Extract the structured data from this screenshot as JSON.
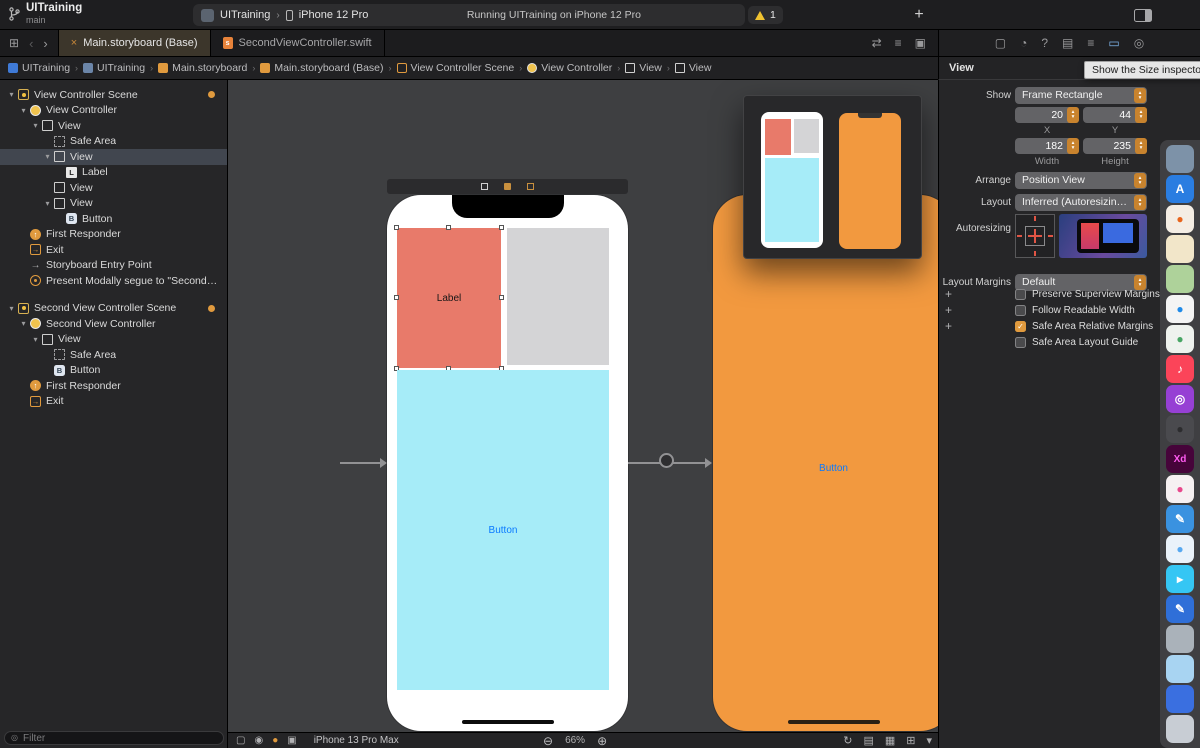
{
  "accent": "#e09a3e",
  "toolbar": {
    "project": "UITraining",
    "branch": "main",
    "scheme_app": "UITraining",
    "scheme_separator": "›",
    "scheme_device": "iPhone 12 Pro",
    "status": "Running UITraining on iPhone 12 Pro",
    "warning_count": "1",
    "add_button": "+"
  },
  "tabbar": {
    "close_glyph": "×",
    "swift_badge": "s",
    "nav_back": "‹",
    "nav_forward": "›",
    "grid_glyph": "⊞",
    "tabs": [
      {
        "label": "Main.storyboard (Base)"
      },
      {
        "label": "SecondViewController.swift"
      }
    ],
    "right_icons": [
      {
        "name": "editor-arrangement-icon",
        "glyph": "⇄"
      },
      {
        "name": "minimap-icon",
        "glyph": "≡"
      },
      {
        "name": "add-editor-icon",
        "glyph": "▣"
      }
    ]
  },
  "breadcrumb": {
    "separator": "›",
    "items": [
      {
        "icon": "app",
        "label": "UITraining"
      },
      {
        "icon": "folder",
        "label": "UITraining"
      },
      {
        "icon": "storyboard",
        "label": "Main.storyboard"
      },
      {
        "icon": "storyboard",
        "label": "Main.storyboard (Base)"
      },
      {
        "icon": "scene",
        "label": "View Controller Scene"
      },
      {
        "icon": "vc",
        "label": "View Controller"
      },
      {
        "icon": "view",
        "label": "View"
      },
      {
        "icon": "view",
        "label": "View"
      }
    ]
  },
  "outline": {
    "filter_placeholder": "Filter",
    "items": [
      {
        "label": "View Controller Scene",
        "indent": 0,
        "icon": "scene",
        "chevron": true,
        "dot": true
      },
      {
        "label": "View Controller",
        "indent": 1,
        "icon": "vc",
        "chevron": true
      },
      {
        "label": "View",
        "indent": 2,
        "icon": "view",
        "chevron": true
      },
      {
        "label": "Safe Area",
        "indent": 3,
        "icon": "safearea"
      },
      {
        "label": "View",
        "indent": 3,
        "icon": "view",
        "chevron": true,
        "selected": true
      },
      {
        "label": "Label",
        "indent": 4,
        "icon": "label"
      },
      {
        "label": "View",
        "indent": 3,
        "icon": "view"
      },
      {
        "label": "View",
        "indent": 3,
        "icon": "view",
        "chevron": true
      },
      {
        "label": "Button",
        "indent": 4,
        "icon": "button"
      },
      {
        "label": "First Responder",
        "indent": 1,
        "icon": "responder"
      },
      {
        "label": "Exit",
        "indent": 1,
        "icon": "exit"
      },
      {
        "label": "Storyboard Entry Point",
        "indent": 1,
        "icon": "entry"
      },
      {
        "label": "Present Modally segue to \"Second…",
        "indent": 1,
        "icon": "segue"
      },
      {
        "label": "Second View Controller Scene",
        "indent": 0,
        "icon": "scene",
        "chevron": true,
        "dot": true,
        "gap_before": true
      },
      {
        "label": "Second View Controller",
        "indent": 1,
        "icon": "vc",
        "chevron": true
      },
      {
        "label": "View",
        "indent": 2,
        "icon": "view",
        "chevron": true
      },
      {
        "label": "Safe Area",
        "indent": 3,
        "icon": "safearea"
      },
      {
        "label": "Button",
        "indent": 3,
        "icon": "button"
      },
      {
        "label": "First Responder",
        "indent": 1,
        "icon": "responder"
      },
      {
        "label": "Exit",
        "indent": 1,
        "icon": "exit"
      }
    ]
  },
  "canvas": {
    "phone1": {
      "label": "Label",
      "button": "Button"
    },
    "phone2": {
      "button": "Button"
    }
  },
  "canvas_bar": {
    "device": "iPhone 13 Pro Max",
    "zoom": "66%",
    "zoom_out": "⊖",
    "zoom_in": "⊕",
    "left_icons": [
      {
        "name": "device-bezels-icon",
        "glyph": "▢"
      },
      {
        "name": "orientation-icon",
        "glyph": "◉"
      },
      {
        "name": "appearance-icon",
        "glyph": "●",
        "color": "#e09a3e"
      },
      {
        "name": "adjust-variants-icon",
        "glyph": "▣"
      }
    ],
    "right_icons": [
      {
        "name": "update-frames-icon",
        "glyph": "↻"
      },
      {
        "name": "stack-icon",
        "glyph": "▤"
      },
      {
        "name": "align-icon",
        "glyph": "▦"
      },
      {
        "name": "add-constraints-icon",
        "glyph": "⊞"
      },
      {
        "name": "resolve-autolayout-icon",
        "glyph": "▾"
      }
    ]
  },
  "inspector": {
    "pane_title": "View",
    "tooltip": "Show the Size inspector",
    "tabs": [
      {
        "name": "file-inspector-tab",
        "glyph": "▢"
      },
      {
        "name": "history-inspector-tab",
        "glyph": "◔"
      },
      {
        "name": "quick-help-inspector-tab",
        "glyph": "?"
      },
      {
        "name": "identity-inspector-tab",
        "glyph": "▤"
      },
      {
        "name": "attributes-inspector-tab",
        "glyph": "≡"
      },
      {
        "name": "size-inspector-tab",
        "glyph": "▭",
        "active": true
      },
      {
        "name": "connections-inspector-tab",
        "glyph": "◎"
      }
    ],
    "show": {
      "label": "Show",
      "value": "Frame Rectangle"
    },
    "position": {
      "x": "20",
      "y": "44",
      "x_label": "X",
      "y_label": "Y",
      "width": "182",
      "height": "235",
      "width_label": "Width",
      "height_label": "Height"
    },
    "arrange": {
      "label": "Arrange",
      "value": "Position View"
    },
    "layout": {
      "label": "Layout",
      "value": "Inferred (Autoresizing Mas…"
    },
    "autoresizing_label": "Autoresizing",
    "margins": {
      "label": "Layout Margins",
      "value": "Default"
    },
    "checks": [
      {
        "label": "Preserve Superview Margins",
        "checked": false,
        "plus": "+"
      },
      {
        "label": "Follow Readable Width",
        "checked": false,
        "plus": "+"
      },
      {
        "label": "Safe Area Relative Margins",
        "checked": true,
        "plus": "+"
      },
      {
        "label": "Safe Area Layout Guide",
        "checked": false,
        "plus": ""
      }
    ]
  },
  "dock": {
    "icons": [
      {
        "name": "finder-icon",
        "bg": "#7d92a8"
      },
      {
        "name": "app-store-icon",
        "bg": "#2a7de1",
        "glyph": "A",
        "fg": "#ffffff"
      },
      {
        "name": "firefox-icon",
        "bg": "#f4ede4",
        "glyph": "●",
        "fg": "#e8641c"
      },
      {
        "name": "notes-icon",
        "bg": "#f2e6c9"
      },
      {
        "name": "photos-icon",
        "bg": "#aed29a"
      },
      {
        "name": "safari-icon",
        "bg": "#f4f4f4",
        "glyph": "●",
        "fg": "#1f8ae8"
      },
      {
        "name": "chrome-icon",
        "bg": "#eef2ee",
        "glyph": "●",
        "fg": "#48a564"
      },
      {
        "name": "music-icon",
        "bg": "#fb4459",
        "glyph": "♪",
        "fg": "#ffffff"
      },
      {
        "name": "podcasts-icon",
        "bg": "#9640d4",
        "glyph": "◎",
        "fg": "#ffffff"
      },
      {
        "name": "camera-icon",
        "bg": "#4a4a4e",
        "glyph": "●",
        "fg": "#2c2c2e"
      },
      {
        "name": "adobe-xd-icon",
        "bg": "#46043a",
        "glyph": "Xd",
        "fg": "#ff5bf1"
      },
      {
        "name": "pink-app-icon",
        "bg": "#f6f0f2",
        "glyph": "●",
        "fg": "#e8488c"
      },
      {
        "name": "pages-icon",
        "bg": "#3a92e0",
        "glyph": "✎",
        "fg": "#ffffff"
      },
      {
        "name": "preview-icon",
        "bg": "#eaf2fa",
        "glyph": "●",
        "fg": "#57a8f0"
      },
      {
        "name": "facetime-icon",
        "bg": "#35c6f4",
        "glyph": "▸",
        "fg": "#ffffff"
      },
      {
        "name": "draw-app-icon",
        "bg": "#2f6fd8",
        "glyph": "✎",
        "fg": "#ffffff"
      },
      {
        "name": "gray-app-icon",
        "bg": "#aab2ba"
      },
      {
        "name": "sky-app-icon",
        "bg": "#a8d4f2"
      },
      {
        "name": "blue-app-icon",
        "bg": "#3a6fe0"
      },
      {
        "name": "trash-icon",
        "bg": "#c8cdd4"
      }
    ]
  }
}
